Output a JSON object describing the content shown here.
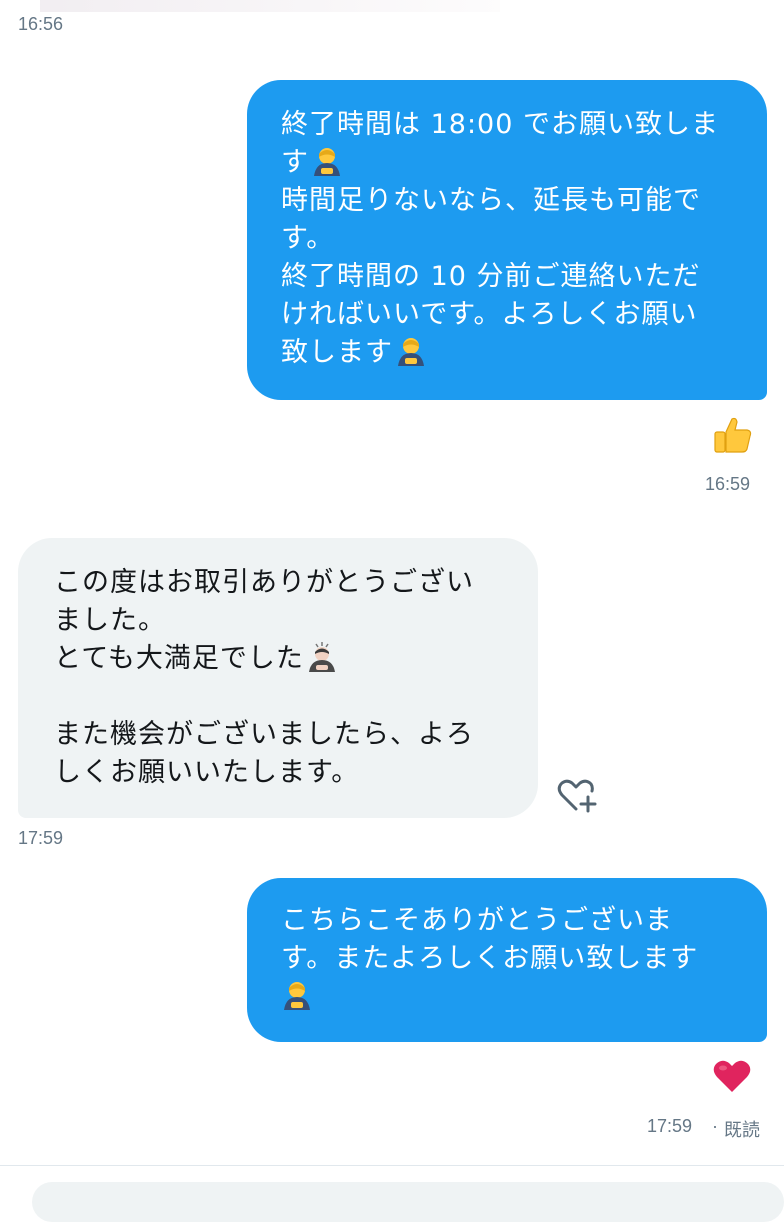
{
  "timestamps": {
    "t1": "16:56",
    "t2": "16:59",
    "t3": "17:59",
    "t4": "17:59",
    "read_status": "既読"
  },
  "messages": [
    {
      "direction": "sent",
      "lines": [
        "終了時間は 18:00 でお願い致しま",
        "す",
        "時間足りないなら、延長も可能で",
        "す。",
        "終了時間の 10 分前ご連絡いただ",
        "ければいいです。よろしくお願い",
        "致します"
      ],
      "reaction": "thumbs-up"
    },
    {
      "direction": "received",
      "lines": [
        "この度はお取引ありがとうござい",
        "ました。",
        "とても大満足でした",
        "",
        "また機会がございましたら、よろ",
        "しくお願いいたします。"
      ],
      "reaction": "add-reaction"
    },
    {
      "direction": "sent",
      "lines": [
        "こちらこそありがとうございま",
        "す。またよろしくお願い致します",
        ""
      ],
      "reaction": "red-heart"
    }
  ],
  "colors": {
    "sent_bubble": "#1d9bf0",
    "received_bubble": "#eff3f4",
    "timestamp": "#657786",
    "heart": "#e0245e"
  }
}
